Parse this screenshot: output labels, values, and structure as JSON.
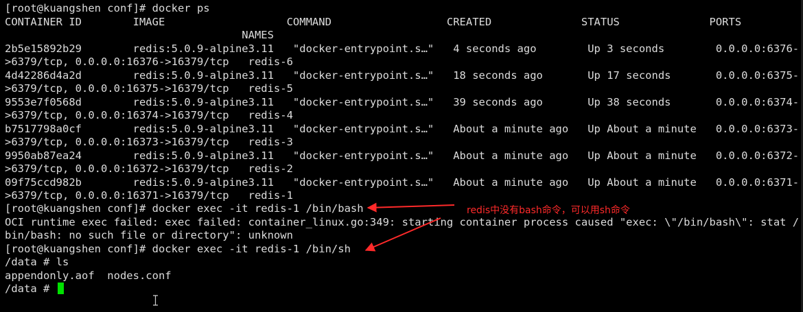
{
  "terminal": {
    "lines": [
      "[root@kuangshen conf]# docker ps",
      "CONTAINER ID        IMAGE                   COMMAND                  CREATED              STATUS              PORTS",
      "                                     NAMES",
      "2b5e15892b29        redis:5.0.9-alpine3.11   \"docker-entrypoint.s…\"   4 seconds ago        Up 3 seconds        0.0.0.0:6376-",
      ">6379/tcp, 0.0.0.0:16376->16379/tcp   redis-6",
      "4d42286d4a2d        redis:5.0.9-alpine3.11   \"docker-entrypoint.s…\"   18 seconds ago       Up 17 seconds       0.0.0.0:6375-",
      ">6379/tcp, 0.0.0.0:16375->16379/tcp   redis-5",
      "9553e7f0568d        redis:5.0.9-alpine3.11   \"docker-entrypoint.s…\"   39 seconds ago       Up 38 seconds       0.0.0.0:6374-",
      ">6379/tcp, 0.0.0.0:16374->16379/tcp   redis-4",
      "b7517798a0cf        redis:5.0.9-alpine3.11   \"docker-entrypoint.s…\"   About a minute ago   Up About a minute   0.0.0.0:6373-",
      ">6379/tcp, 0.0.0.0:16373->16379/tcp   redis-3",
      "9950ab87ea24        redis:5.0.9-alpine3.11   \"docker-entrypoint.s…\"   About a minute ago   Up About a minute   0.0.0.0:6372-",
      ">6379/tcp, 0.0.0.0:16372->16379/tcp   redis-2",
      "09f75ccd982b        redis:5.0.9-alpine3.11   \"docker-entrypoint.s…\"   About a minute ago   Up About a minute   0.0.0.0:6371-",
      ">6379/tcp, 0.0.0.0:16371->16379/tcp   redis-1",
      "[root@kuangshen conf]# docker exec -it redis-1 /bin/bash",
      "OCI runtime exec failed: exec failed: container_linux.go:349: starting container process caused \"exec: \\\"/bin/bash\\\": stat /",
      "bin/bash: no such file or directory\": unknown",
      "[root@kuangshen conf]# docker exec -it redis-1 /bin/sh",
      "/data # ls",
      "appendonly.aof  nodes.conf",
      "/data # "
    ],
    "annotation": "redis中没有bash命令，可以用sh命令",
    "colors": {
      "background": "#000000",
      "text": "#dcdcdc",
      "cursor": "#00e000",
      "annotation": "#ff2a2a"
    }
  }
}
